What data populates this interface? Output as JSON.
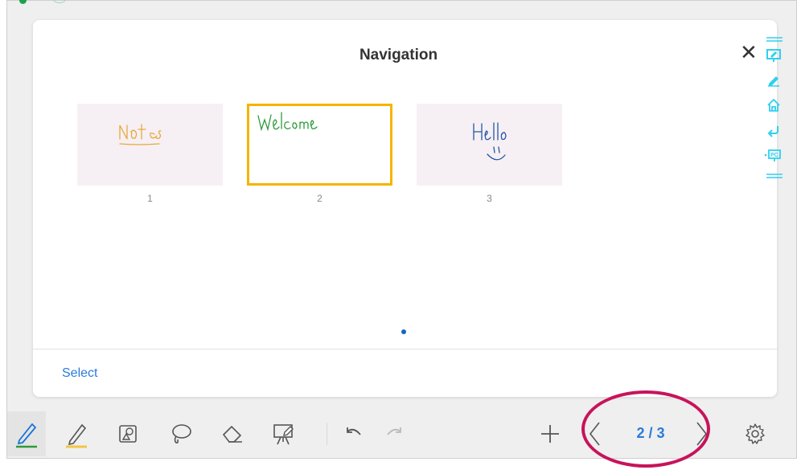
{
  "dialog": {
    "title": "Navigation",
    "close_icon": "close-icon",
    "select_label": "Select"
  },
  "pages": [
    {
      "number": "1",
      "handwriting": "Notes",
      "ink_color": "#e8a83a",
      "selected": false
    },
    {
      "number": "2",
      "handwriting": "Welcome",
      "ink_color": "#2e9b3b",
      "selected": true
    },
    {
      "number": "3",
      "handwriting": "Hello",
      "ink_color": "#2456a8",
      "selected": false
    }
  ],
  "side_tools": [
    "monitor-edit-icon",
    "pen-icon",
    "home-icon",
    "return-icon",
    "pc-icon"
  ],
  "toolbar": {
    "tools": [
      "pen-icon",
      "highlighter-icon",
      "shapes-icon",
      "lasso-icon",
      "eraser-icon",
      "presenter-icon"
    ],
    "undo_icon": "undo-icon",
    "redo_icon": "redo-icon",
    "add_page_icon": "plus-icon",
    "page_indicator": "2 / 3",
    "settings_icon": "gear-icon"
  },
  "colors": {
    "accent": "#2a7bd8",
    "selected_border": "#f5b400",
    "annotation": "#c8135b",
    "side_tool": "#2ed0f0"
  }
}
